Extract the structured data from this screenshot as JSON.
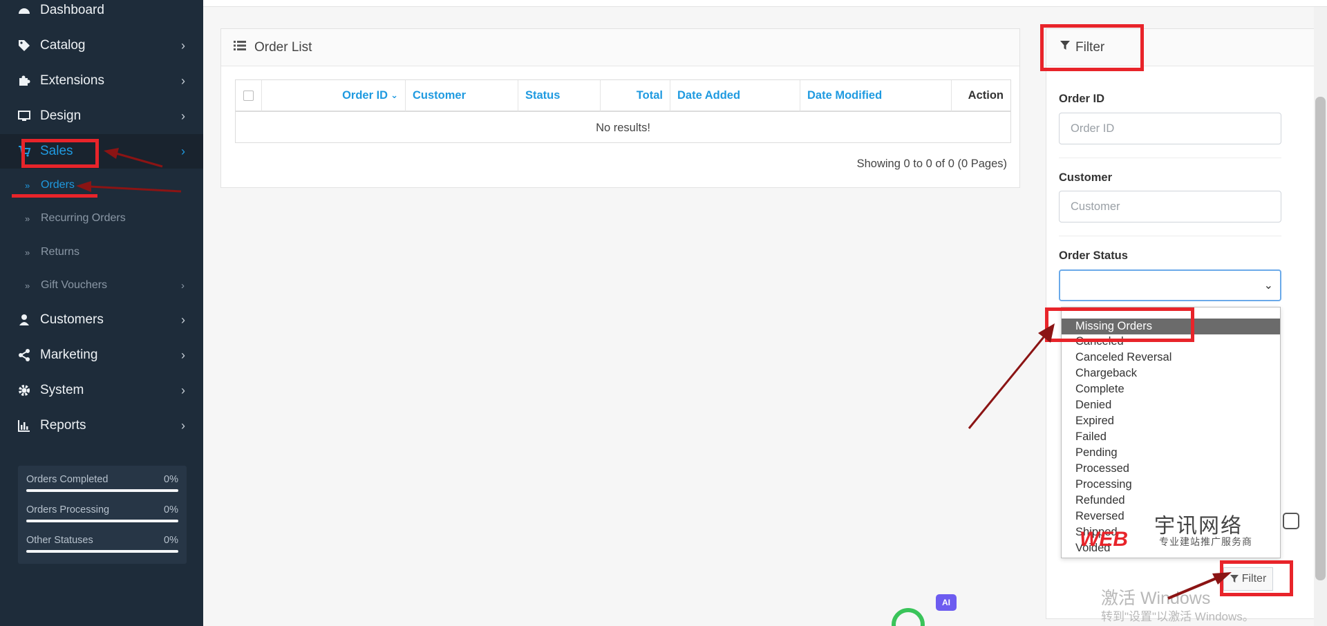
{
  "sidebar": {
    "items": [
      {
        "label": "Dashboard",
        "icon": "dashboard-icon"
      },
      {
        "label": "Catalog",
        "icon": "tags-icon"
      },
      {
        "label": "Extensions",
        "icon": "puzzle-icon"
      },
      {
        "label": "Design",
        "icon": "monitor-icon"
      },
      {
        "label": "Sales",
        "icon": "cart-icon"
      },
      {
        "label": "Customers",
        "icon": "user-icon"
      },
      {
        "label": "Marketing",
        "icon": "share-icon"
      },
      {
        "label": "System",
        "icon": "gear-icon"
      },
      {
        "label": "Reports",
        "icon": "bar-chart-icon"
      }
    ],
    "sales_sub": [
      {
        "label": "Orders"
      },
      {
        "label": "Recurring Orders"
      },
      {
        "label": "Returns"
      },
      {
        "label": "Gift Vouchers"
      }
    ],
    "stats": [
      {
        "label": "Orders Completed",
        "value": "0%",
        "progress": 0
      },
      {
        "label": "Orders Processing",
        "value": "0%",
        "progress": 0
      },
      {
        "label": "Other Statuses",
        "value": "0%",
        "progress": 0
      }
    ]
  },
  "order_list": {
    "title": "Order List",
    "columns": [
      "Order ID",
      "Customer",
      "Status",
      "Total",
      "Date Added",
      "Date Modified",
      "Action"
    ],
    "empty_text": "No results!",
    "pagination": "Showing 0 to 0 of 0 (0 Pages)"
  },
  "filter": {
    "title": "Filter",
    "order_id_label": "Order ID",
    "order_id_placeholder": "Order ID",
    "customer_label": "Customer",
    "customer_placeholder": "Customer",
    "status_label": "Order Status",
    "status_value": "",
    "options": [
      "Missing Orders",
      "Canceled",
      "Canceled Reversal",
      "Chargeback",
      "Complete",
      "Denied",
      "Expired",
      "Failed",
      "Pending",
      "Processed",
      "Processing",
      "Refunded",
      "Reversed",
      "Shipped",
      "Voided"
    ],
    "selected_option": "Missing Orders",
    "button_label": "Filter"
  },
  "overlay": {
    "watermark_title": "激活 Windows",
    "watermark_sub": "转到\"设置\"以激活 Windows。",
    "logo_web": "WEB",
    "logo_name": "宇讯网络",
    "logo_tagline": "专业建站推广服务商",
    "ai_badge": "AI"
  },
  "colors": {
    "sidebar_bg": "#1e2c3a",
    "accent": "#1f9ae0",
    "annotation_red": "#e8242a"
  }
}
